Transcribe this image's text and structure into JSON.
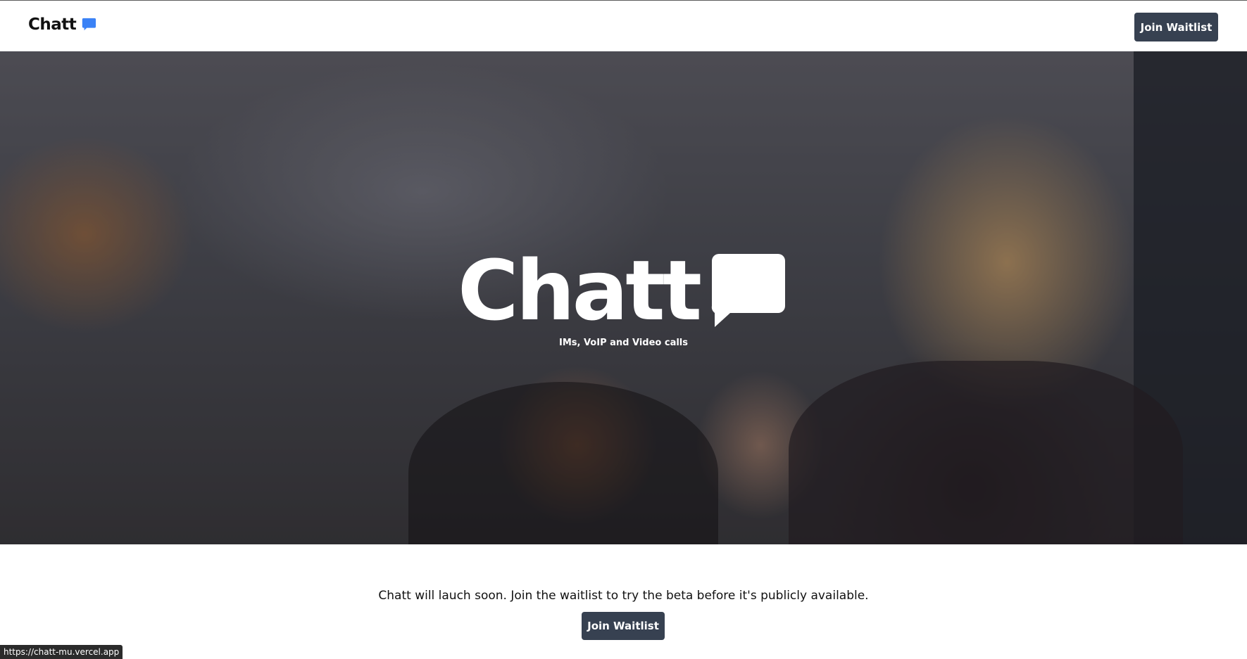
{
  "header": {
    "logo_text": "Chatt",
    "logo_icon": "chat-bubble-icon",
    "join_button_label": "Join Waitlist"
  },
  "hero": {
    "title": "Chatt",
    "icon": "speech-bubble-icon",
    "tagline": "IMs, VoIP and Video calls"
  },
  "cta": {
    "text": "Chatt will lauch soon. Join the waitlist to try the beta before it's publicly available.",
    "join_button_label": "Join Waitlist"
  },
  "status_bar": {
    "url": "https://chatt-mu.vercel.app"
  },
  "colors": {
    "accent_blue": "#3b82f6",
    "button_bg": "#374151",
    "button_text": "#ffffff"
  }
}
